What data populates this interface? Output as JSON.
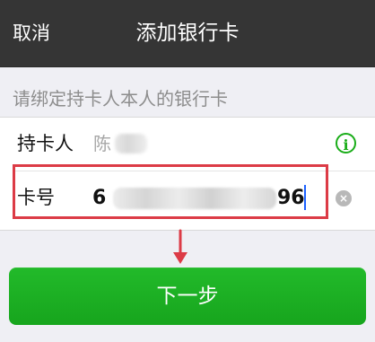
{
  "navbar": {
    "cancel_label": "取消",
    "title": "添加银行卡"
  },
  "hint": {
    "text": "请绑定持卡人本人的银行卡"
  },
  "cardholder": {
    "label": "持卡人",
    "name_visible": "陈"
  },
  "card_number": {
    "label": "卡号",
    "visible_start": "6",
    "visible_end": "96"
  },
  "actions": {
    "next_label": "下一步"
  },
  "icons": {
    "info": "info-icon",
    "clear": "close-circle-icon",
    "arrow": "arrow-down-icon"
  },
  "colors": {
    "navbar_bg": "#353535",
    "page_bg": "#efeff4",
    "accent_green": "#1aad19",
    "highlight_red": "#dc3b46",
    "caret_blue": "#1d62ff"
  }
}
